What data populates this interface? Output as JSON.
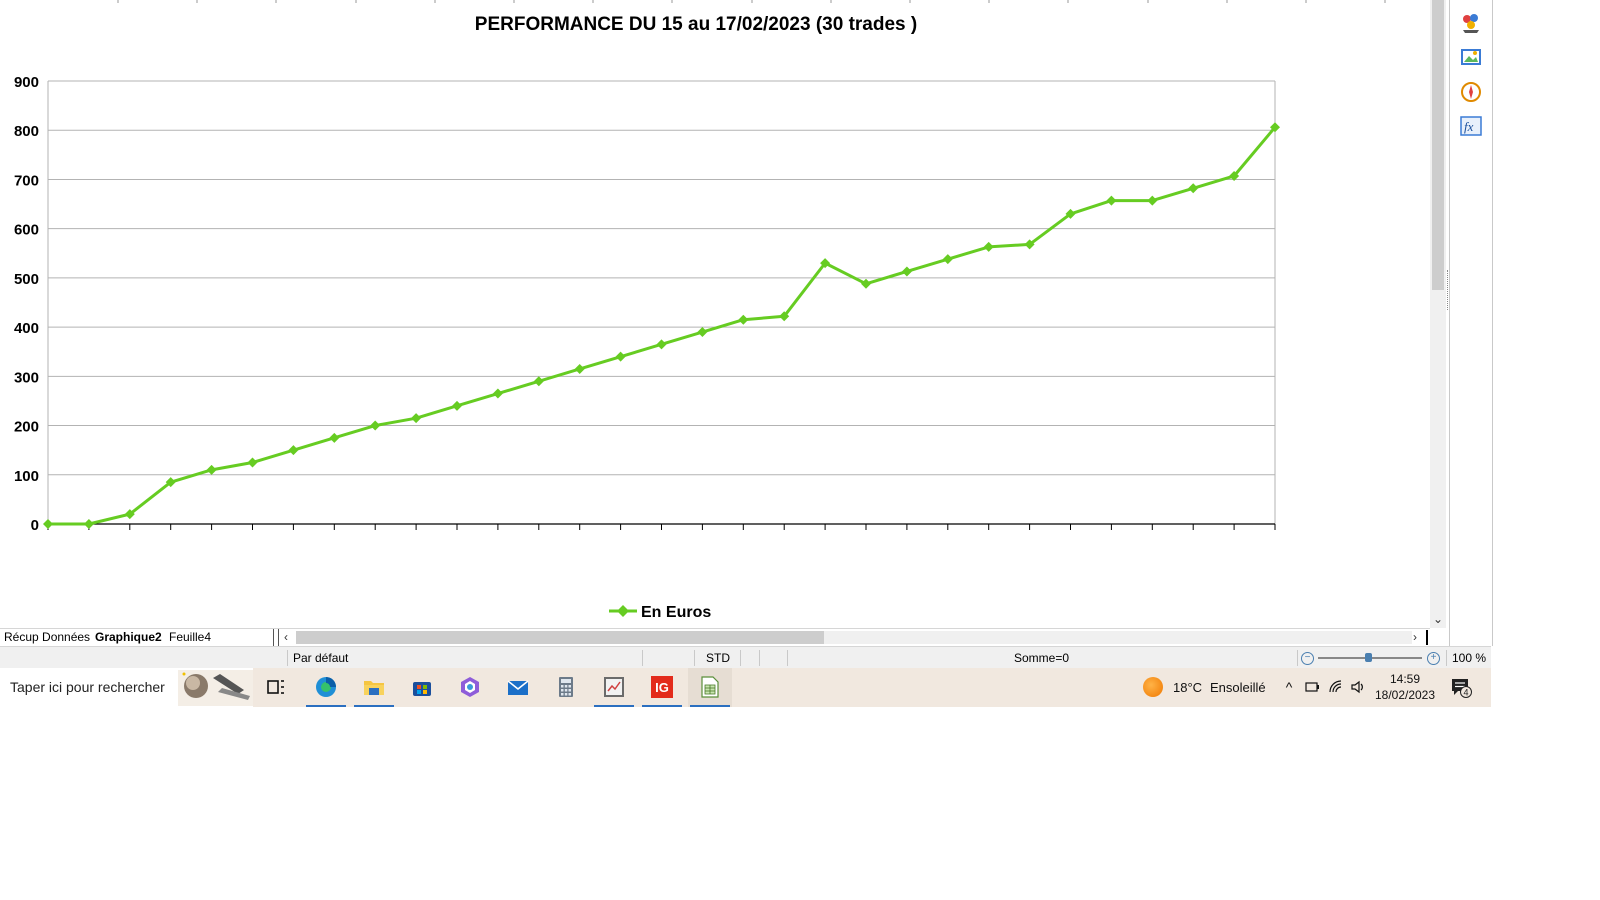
{
  "chart_data": {
    "type": "line",
    "title": "PERFORMANCE DU 15 au 17/02/2023 (30 trades )",
    "xlabel": "",
    "ylabel": "",
    "x": [
      1,
      2,
      3,
      4,
      5,
      6,
      7,
      8,
      9,
      10,
      11,
      12,
      13,
      14,
      15,
      16,
      17,
      18,
      19,
      20,
      21,
      22,
      23,
      24,
      25,
      26,
      27,
      28,
      29,
      30,
      31
    ],
    "ylim": [
      0,
      900
    ],
    "yticks": [
      "0",
      "100",
      "200",
      "300",
      "400",
      "500",
      "600",
      "700",
      "800",
      "900"
    ],
    "grid": true,
    "legend": "bottom",
    "series": [
      {
        "name": "En Euros",
        "color": "#66cc22",
        "values": [
          0,
          0,
          20,
          85,
          110,
          125,
          150,
          175,
          200,
          215,
          240,
          265,
          290,
          315,
          340,
          365,
          390,
          415,
          422,
          530,
          488,
          513,
          538,
          563,
          568,
          630,
          657,
          657,
          682,
          707,
          806
        ]
      }
    ]
  },
  "sheet_tabs": {
    "tabs": [
      "Récup Données",
      "Graphique2",
      "Feuille4"
    ],
    "active": "Graphique2"
  },
  "statusbar": {
    "page_style": "Par défaut",
    "selection_mode": "STD",
    "sum": "Somme=0",
    "zoom": "100 %",
    "zoom_level": 100
  },
  "taskbar": {
    "search_placeholder": "Taper ici pour rechercher",
    "apps": [
      "task-view",
      "edge",
      "file-explorer",
      "microsoft-store",
      "copilot",
      "mail",
      "calculator",
      "stock-app",
      "ig",
      "libreoffice-calc"
    ],
    "weather_temp": "18°C",
    "weather_text": "Ensoleillé",
    "time": "14:59",
    "date": "18/02/2023",
    "notifications": "4"
  },
  "sidebar": {
    "icons": [
      "styles-icon",
      "gallery-icon",
      "navigator-icon",
      "functions-icon"
    ]
  }
}
